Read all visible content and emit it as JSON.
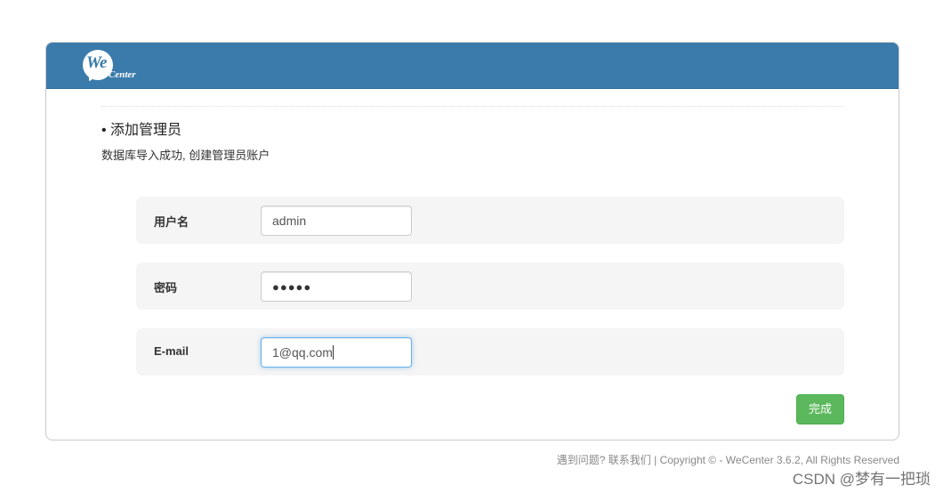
{
  "logo": {
    "we": "We",
    "center": "Center"
  },
  "section": {
    "title": "• 添加管理员",
    "description": "数据库导入成功, 创建管理员账户"
  },
  "form": {
    "username": {
      "label": "用户名",
      "value": "admin"
    },
    "password": {
      "label": "密码",
      "masked_value": "●●●●●"
    },
    "email": {
      "label": "E-mail",
      "value": "1@qq.com"
    },
    "submit_label": "完成"
  },
  "footer": {
    "text": "遇到问题? 联系我们 | Copyright © - WeCenter 3.6.2, All Rights Reserved"
  },
  "watermark": {
    "text": "CSDN @梦有一把琐"
  },
  "colors": {
    "header": "#3a7bab",
    "submit": "#5cb85c",
    "row_bg": "#f5f5f5",
    "focus": "#66afe9"
  }
}
